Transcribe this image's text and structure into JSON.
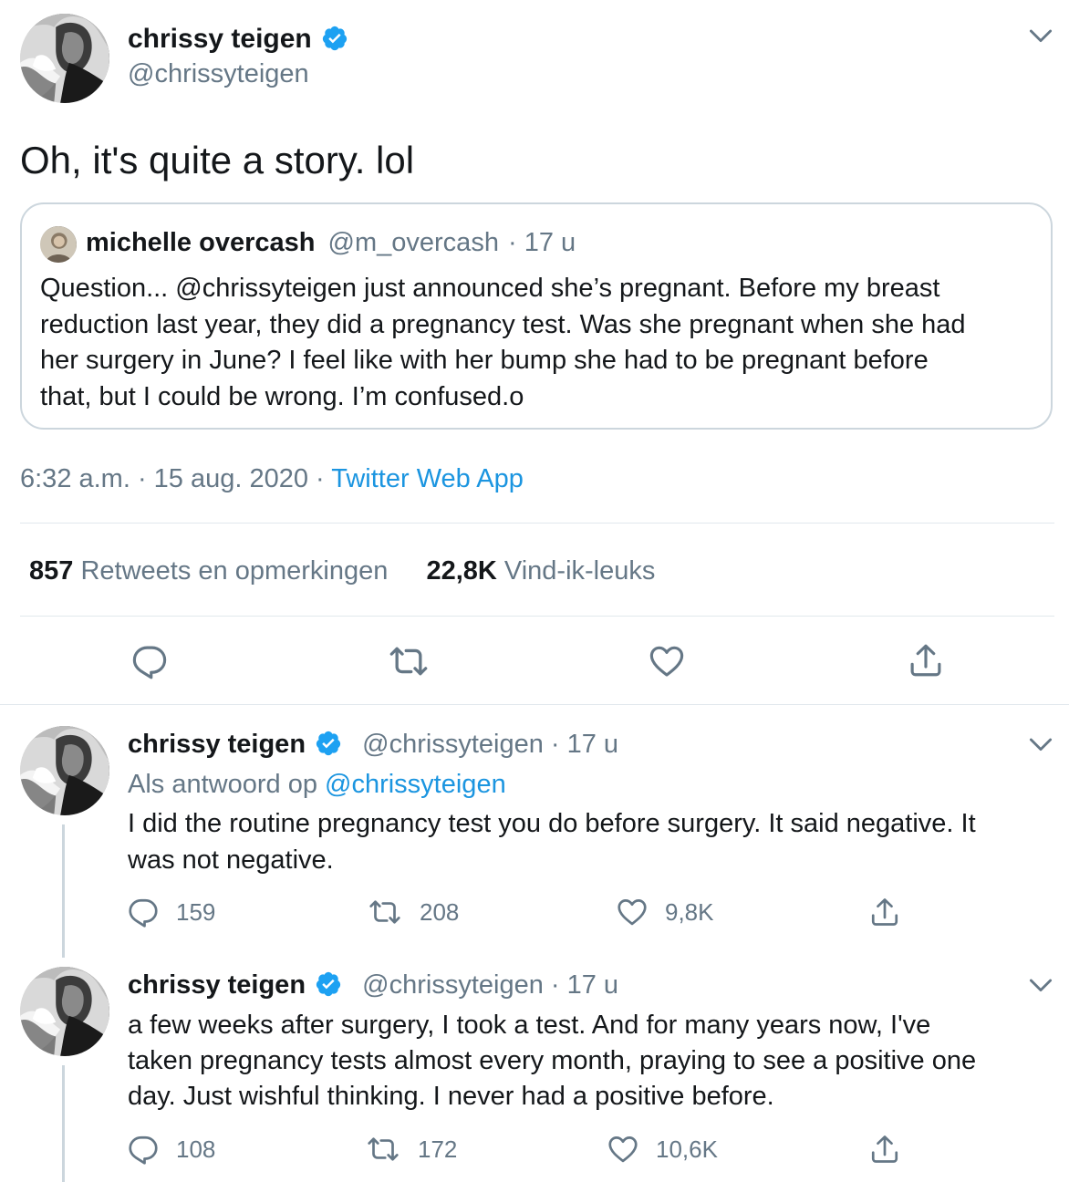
{
  "main_tweet": {
    "author_name": "chrissy teigen",
    "handle": "@chrissyteigen",
    "text": "Oh, it's quite a story. lol",
    "quoted": {
      "author_name": "michelle overcash",
      "handle": "@m_overcash",
      "time": "· 17 u",
      "text_lines": [
        "Question... @chrissyteigen just announced she’s pregnant. Before my breast",
        "reduction last year, they did a pregnancy test. Was she pregnant when she had",
        "her surgery in June? I feel like with her bump she had to be pregnant before",
        "that, but I could be wrong. I’m confused.o"
      ]
    },
    "timestamp": "6:32 a.m. · 15 aug. 2020 · ",
    "source": "Twitter Web App",
    "stats": {
      "retweets_count": "857",
      "retweets_label": "Retweets en opmerkingen",
      "likes_count": "22,8K",
      "likes_label": "Vind-ik-leuks"
    }
  },
  "replies": [
    {
      "author_name": "chrissy teigen",
      "handle": "@chrissyteigen",
      "time": "· 17 u",
      "reply_prefix": "Als antwoord op ",
      "reply_to": "@chrissyteigen",
      "text_lines": [
        "I did the routine pregnancy test you do before surgery. It said negative. It",
        "was not negative."
      ],
      "counts": {
        "replies": "159",
        "retweets": "208",
        "likes": "9,8K"
      }
    },
    {
      "author_name": "chrissy teigen",
      "handle": "@chrissyteigen",
      "time": "· 17 u",
      "text_lines": [
        "a few weeks after surgery, I took a test. And for many years now, I've",
        "taken pregnancy tests almost every month, praying to see a positive one",
        "day. Just wishful thinking. I never had a positive before."
      ],
      "counts": {
        "replies": "108",
        "retweets": "172",
        "likes": "10,6K"
      }
    }
  ],
  "colors": {
    "accent": "#1b95e0",
    "muted": "#657786",
    "text": "#14171a",
    "border": "#e1e8ed",
    "verified": "#1da1f2"
  },
  "icons": [
    "verified-badge-icon",
    "chevron-down-icon",
    "reply-icon",
    "retweet-icon",
    "like-icon",
    "share-icon"
  ]
}
